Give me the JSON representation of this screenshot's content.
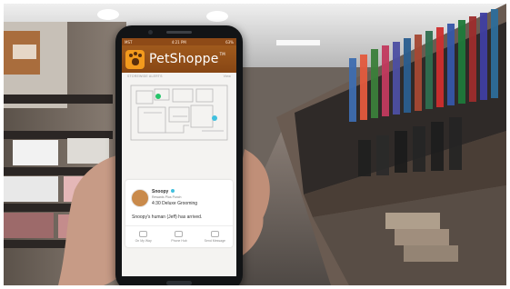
{
  "app": {
    "name": "PetShoppe",
    "trademark": "TM"
  },
  "status_bar": {
    "carrier": "MST",
    "time": "4:21 PM",
    "battery": "63%"
  },
  "section": {
    "title": "STOREWIDE ALERTS",
    "action": "View"
  },
  "notification": {
    "pet_name": "Snoopy",
    "location": "Rewards Plus Punch",
    "appointment": "4:30 Deluxe Grooming",
    "message": "Snoopy's human (Jeff) has arrived.",
    "actions": [
      {
        "label": "On My Way"
      },
      {
        "label": "Phone Hub"
      },
      {
        "label": "Send Message"
      }
    ]
  },
  "colors": {
    "brand_dark": "#874614",
    "brand_orange": "#f39a1d",
    "pin_green": "#25c46a",
    "pin_blue": "#41c0de"
  }
}
